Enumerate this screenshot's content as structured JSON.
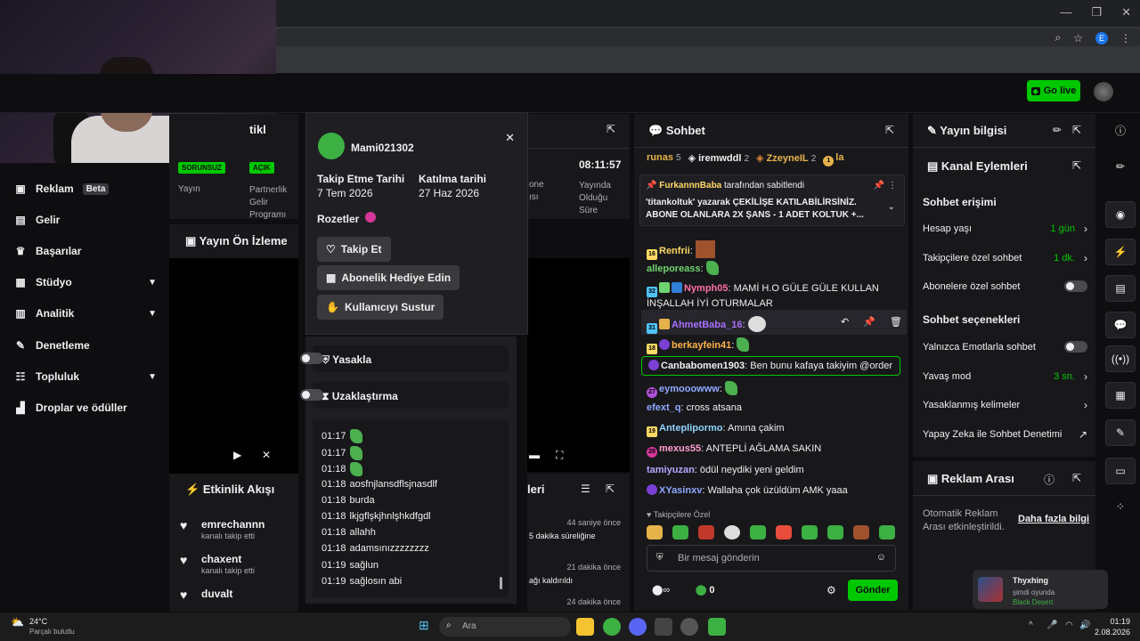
{
  "browser": {
    "tab_controls": [
      "—",
      "❐",
      "✕"
    ]
  },
  "topbar": {
    "go_live": "Go live"
  },
  "leftnav": {
    "items": [
      {
        "label": "Reklam",
        "badge": "Beta",
        "icon": "ad-icon"
      },
      {
        "label": "Gelir",
        "icon": "revenue-icon"
      },
      {
        "label": "Başarılar",
        "icon": "trophy-icon"
      },
      {
        "label": "Stüdyo",
        "icon": "studio-icon",
        "expand": true
      },
      {
        "label": "Analitik",
        "icon": "analytics-icon",
        "expand": true
      },
      {
        "label": "Denetleme",
        "icon": "wrench-icon"
      },
      {
        "label": "Topluluk",
        "icon": "community-icon",
        "expand": true
      },
      {
        "label": "Droplar ve ödüller",
        "icon": "drops-icon"
      }
    ]
  },
  "stats": {
    "title": "tikl",
    "badge1": "SORUNSUZ",
    "badge2": "AÇIK",
    "label1": "Yayın",
    "label2": "Partnerlik Gelir Programı"
  },
  "preview": {
    "title": "Yayın Ön İzleme"
  },
  "activity": {
    "title": "Etkinlik Akışı",
    "items": [
      {
        "name": "emrechannn",
        "sub": "kanalı takip etti"
      },
      {
        "name": "chaxent",
        "sub": "kanalı takip etti"
      },
      {
        "name": "duvalt",
        "sub": "kanalı takip etti"
      }
    ]
  },
  "stream2": {
    "time": "08:11:57",
    "label1": "one",
    "label2": "ısı",
    "label3": "Yayında Olduğu Süre"
  },
  "activity2": {
    "title": "leri",
    "items": [
      {
        "time": "44 saniye önce",
        "text": "5 dakika süreliğine"
      },
      {
        "time": "21 dakika önce",
        "text": "ağı kaldırıldı"
      },
      {
        "time": "24 dakika önce",
        "text": ""
      }
    ]
  },
  "usercard": {
    "username": "Mami021302",
    "follow_label": "Takip Etme Tarihi",
    "follow_date": "7 Tem 2026",
    "join_label": "Katılma tarihi",
    "join_date": "27 Haz 2026",
    "badges_label": "Rozetler",
    "follow_btn": "Takip Et",
    "gift_btn": "Abonelik Hediye Edin",
    "mute_btn": "Kullanıcıyı Sustur",
    "ban_label": "Yasakla",
    "timeout_label": "Uzaklaştırma"
  },
  "log": [
    {
      "t": "01:17",
      "m": ""
    },
    {
      "t": "01:17",
      "m": ""
    },
    {
      "t": "01:18",
      "m": ""
    },
    {
      "t": "01:18",
      "m": "aosfnjlansdflsjnasdlf"
    },
    {
      "t": "01:18",
      "m": "burda"
    },
    {
      "t": "01:18",
      "m": "lkjgflşkjhnlşhkdfgdl"
    },
    {
      "t": "01:18",
      "m": "allahh"
    },
    {
      "t": "01:18",
      "m": "adamsınızzzzzzzz"
    },
    {
      "t": "01:19",
      "m": "sağlun"
    },
    {
      "t": "01:19",
      "m": "sağlosın abi"
    }
  ],
  "chat": {
    "title": "Sohbet",
    "top_users": [
      {
        "name": "runas",
        "n": "5"
      },
      {
        "name": "iremwddl",
        "n": "2"
      },
      {
        "name": "ZzeyneIL",
        "n": "2"
      },
      {
        "name": "la",
        "n": ""
      }
    ],
    "pinned_by": "FurkannnBaba",
    "pinned_suffix": "tarafından sabitlendi",
    "pinned_text": "'titankoltuk' yazarak ÇEKİLİŞE KATILABİLİRSİNİZ. ABONE OLANLARA 2X ŞANS - 1 ADET KOLTUK +...",
    "messages": [
      {
        "user": "Renfrii",
        "color": "#ffd966",
        "text": "",
        "badge": "16"
      },
      {
        "user": "alleporeass",
        "color": "#6fd46f",
        "text": "",
        "badge": ""
      },
      {
        "user": "Nymph05",
        "color": "#ff6fa3",
        "text": "MAMİ H.O GÜLE GÜLE KULLAN İNŞALLAH İYİ OTURMALAR",
        "badge": "32"
      },
      {
        "user": "AhmetBaba_16",
        "color": "#a970ff",
        "text": "",
        "badge": "31"
      },
      {
        "user": "berkayfein41",
        "color": "#ffb347",
        "text": "",
        "badge": "18"
      },
      {
        "user": "Canbabomen1903",
        "color": "#efeff1",
        "text": "Ben bunu kafaya takiyim @order",
        "badge": ""
      },
      {
        "user": "eymooowww",
        "color": "#8fa8ff",
        "text": "",
        "badge": "27"
      },
      {
        "user": "efext_q",
        "color": "#8fa8ff",
        "text": "cross atsana",
        "badge": ""
      },
      {
        "user": "Anteplipormo",
        "color": "#8fd4ff",
        "text": "Amına çakim",
        "badge": "19"
      },
      {
        "user": "mexus55",
        "color": "#ff9ecf",
        "text": "ANTEPLİ AĞLAMA SAKIN",
        "badge": "28"
      },
      {
        "user": "tamiyuzan",
        "color": "#b7a6ff",
        "text": "ödül neydiki yeni geldim",
        "badge": ""
      },
      {
        "user": "XYasinxv",
        "color": "#8fa8ff",
        "text": "Wallaha çok üzüldüm AMK yaaa",
        "badge": ""
      }
    ],
    "followers_only": "Takipçilere Özel",
    "input_placeholder": "Bir mesaj gönderin",
    "points": "0",
    "send": "Gönder"
  },
  "info": {
    "title": "Yayın bilgisi",
    "channel_actions": "Kanal Eylemleri",
    "chat_access": "Sohbet erişimi",
    "rows": [
      {
        "label": "Hesap yaşı",
        "value": "1 gün",
        "type": "arrow"
      },
      {
        "label": "Takipçilere özel sohbet",
        "value": "1 dk.",
        "type": "arrow"
      },
      {
        "label": "Abonelere özel sohbet",
        "value": "",
        "type": "toggle"
      }
    ],
    "chat_options": "Sohbet seçenekleri",
    "rows2": [
      {
        "label": "Yalnızca Emotlarla sohbet",
        "value": "",
        "type": "toggle"
      },
      {
        "label": "Yavaş mod",
        "value": "3 sn.",
        "type": "arrow"
      },
      {
        "label": "Yasaklanmış kelimeler",
        "value": "",
        "type": "arrow"
      },
      {
        "label": "Yapay Zeka ile Sohbet Denetimi",
        "value": "",
        "type": "ext"
      }
    ]
  },
  "ad": {
    "title": "Reklam Arası",
    "text": "Otomatik Reklam Arası etkinleştirildi.",
    "link": "Daha fazla bilgi"
  },
  "toast": {
    "name": "Thyxhing",
    "status": "şimdi oyunda",
    "game": "Black Desert"
  },
  "taskbar": {
    "temp": "24°C",
    "weather": "Parçalı bulutlu",
    "search": "Ara",
    "time": "01:19",
    "date": "2.08.2026"
  }
}
